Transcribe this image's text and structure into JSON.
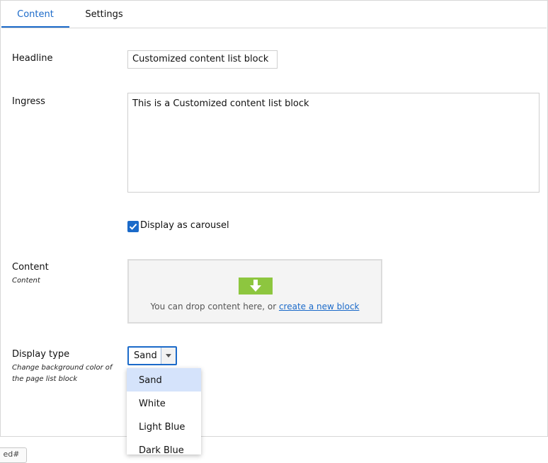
{
  "tabs": [
    {
      "label": "Content",
      "active": true
    },
    {
      "label": "Settings",
      "active": false
    }
  ],
  "fields": {
    "headline": {
      "label": "Headline",
      "value": "Customized content list block"
    },
    "ingress": {
      "label": "Ingress",
      "value": "This is a Customized content list block"
    },
    "carousel": {
      "label": "Display as carousel",
      "checked": true
    },
    "content": {
      "label": "Content",
      "hint": "Content",
      "drop_text": "You can drop content here, or ",
      "drop_link": "create a new block"
    },
    "display_type": {
      "label": "Display type",
      "hint": "Change background color of the page list block",
      "selected": "Sand",
      "options": [
        "Sand",
        "White",
        "Light Blue",
        "Dark Blue"
      ]
    }
  },
  "colors": {
    "accent": "#1b6ac9",
    "drop_icon": "#8dc63f",
    "selected_option_bg": "#d5e3fb"
  },
  "icons": {
    "checkbox": "check-icon",
    "dropzone": "download-arrow-icon",
    "select": "chevron-down-icon"
  },
  "bottom_button": {
    "label": "ed#"
  }
}
